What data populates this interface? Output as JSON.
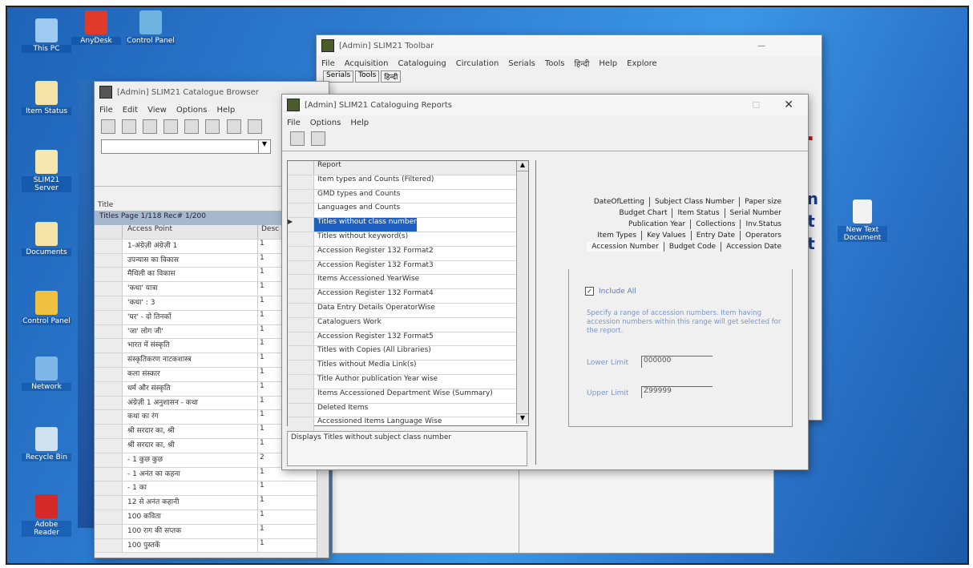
{
  "desktop": {
    "icons_left": [
      {
        "label": "This PC"
      },
      {
        "label": "Recycle Bin"
      },
      {
        "label": "Item Status"
      },
      {
        "label": "SLIM21 Server"
      },
      {
        "label": "Documents"
      },
      {
        "label": "Network"
      },
      {
        "label": "Control Panel"
      },
      {
        "label": "Adobe Reader"
      }
    ],
    "icons_top": [
      {
        "label": "AnyDesk"
      },
      {
        "label": "Control Panel"
      }
    ],
    "icon_right": {
      "label": "New Text Document"
    }
  },
  "toolbar_window": {
    "title": "[Admin] SLIM21 Toolbar",
    "menu": [
      "File",
      "Acquisition",
      "Cataloguing",
      "Circulation",
      "Serials",
      "Tools",
      "हिन्दी",
      "Help",
      "Explore"
    ],
    "tabs": [
      "Serials",
      "Tools",
      "हिन्दी"
    ],
    "logo_char": "1",
    "side_text": [
      "on",
      "nt",
      "nt"
    ]
  },
  "browser_window": {
    "title": "[Admin] SLIM21 Catalogue Browser",
    "menu": [
      "File",
      "Edit",
      "View",
      "Options",
      "Help"
    ],
    "section_label": "Title",
    "header_row": "Titles  Page 1/118 Rec# 1/200",
    "columns": [
      "Access Point",
      "Desc"
    ],
    "rows": [
      {
        "text": "1-अंग्रेज़ी अंग्रेज़ी 1",
        "count": "1"
      },
      {
        "text": "उपन्यास का विकास",
        "count": "1"
      },
      {
        "text": "मैथिली का विकास",
        "count": "1"
      },
      {
        "text": "'कथा' यात्रा",
        "count": "1"
      },
      {
        "text": "'कथा' : 3",
        "count": "1"
      },
      {
        "text": "'घर' - दो  तिनकों",
        "count": "1"
      },
      {
        "text": "'जा' लोग जी'",
        "count": "1"
      },
      {
        "text": "भारत में संस्कृति",
        "count": "1"
      },
      {
        "text": "संस्कृतिकरण नाटकशास्त्र",
        "count": "1"
      },
      {
        "text": "कला संस्कार",
        "count": "1"
      },
      {
        "text": "धर्म और  संस्कृति",
        "count": "1"
      },
      {
        "text": "अंग्रेज़ी 1 अनुशासन - कथा",
        "count": "1"
      },
      {
        "text": "कथा का रंग",
        "count": "1"
      },
      {
        "text": "श्री सरदार का, श्री",
        "count": "1"
      },
      {
        "text": "श्री सरदार का, श्री",
        "count": "1"
      },
      {
        "text": "- 1 कुछ कुछ",
        "count": "2"
      },
      {
        "text": "- 1 अनंत का कहना",
        "count": "1"
      },
      {
        "text": "- 1 का",
        "count": "1"
      },
      {
        "text": "12 से अनंत कहानी",
        "count": "1"
      },
      {
        "text": "100 कविता",
        "count": "1"
      },
      {
        "text": "100 राग की सप्तक",
        "count": "1"
      },
      {
        "text": "100 पुस्तकें",
        "count": "1"
      }
    ]
  },
  "reports_window": {
    "title": "[Admin] SLIM21 Cataloguing Reports",
    "menu": [
      "File",
      "Options",
      "Help"
    ],
    "list_header": "Report",
    "reports": [
      "Item types and Counts (Filtered)",
      "GMD types and Counts",
      "Languages and Counts",
      "Titles without class number",
      "Titles without keyword(s)",
      "Accession Register 132 Format2",
      "Accession Register 132 Format3",
      "Items Accessioned YearWise",
      "Accession Register 132 Format4",
      "Data Entry Details OperatorWise",
      "Cataloguers Work",
      "Accession Register 132 Format5",
      "Titles with Copies (All Libraries)",
      "Titles without Media Link(s)",
      "Title Author publication Year wise",
      "Items Accessioned Department Wise (Summary)",
      "Deleted Items",
      "Accessioned Items Language Wise"
    ],
    "selected_index": 3,
    "status_text": "Displays Titles without subject class number",
    "tab_rows": [
      [
        "DateOfLetting",
        "Subject Class Number",
        "Paper size"
      ],
      [
        "Budget Chart",
        "Item Status",
        "Serial Number"
      ],
      [
        "Publication Year",
        "Collections",
        "Inv.Status"
      ],
      [
        "Item Types",
        "Key Values",
        "Entry Date",
        "Operators"
      ],
      [
        "Accession Number",
        "Budget Code",
        "Accession Date"
      ]
    ],
    "include_all_label": "Include All",
    "include_all_checked": true,
    "help_text": "Specify a range of accession numbers. Item having accession numbers within this range will get selected for the report.",
    "lower_label": "Lower Limit",
    "lower_value": "000000",
    "upper_label": "Upper Limit",
    "upper_value": "Z99999",
    "close_glyph": "✕",
    "min_glyph": "—",
    "max_glyph": "☐"
  }
}
